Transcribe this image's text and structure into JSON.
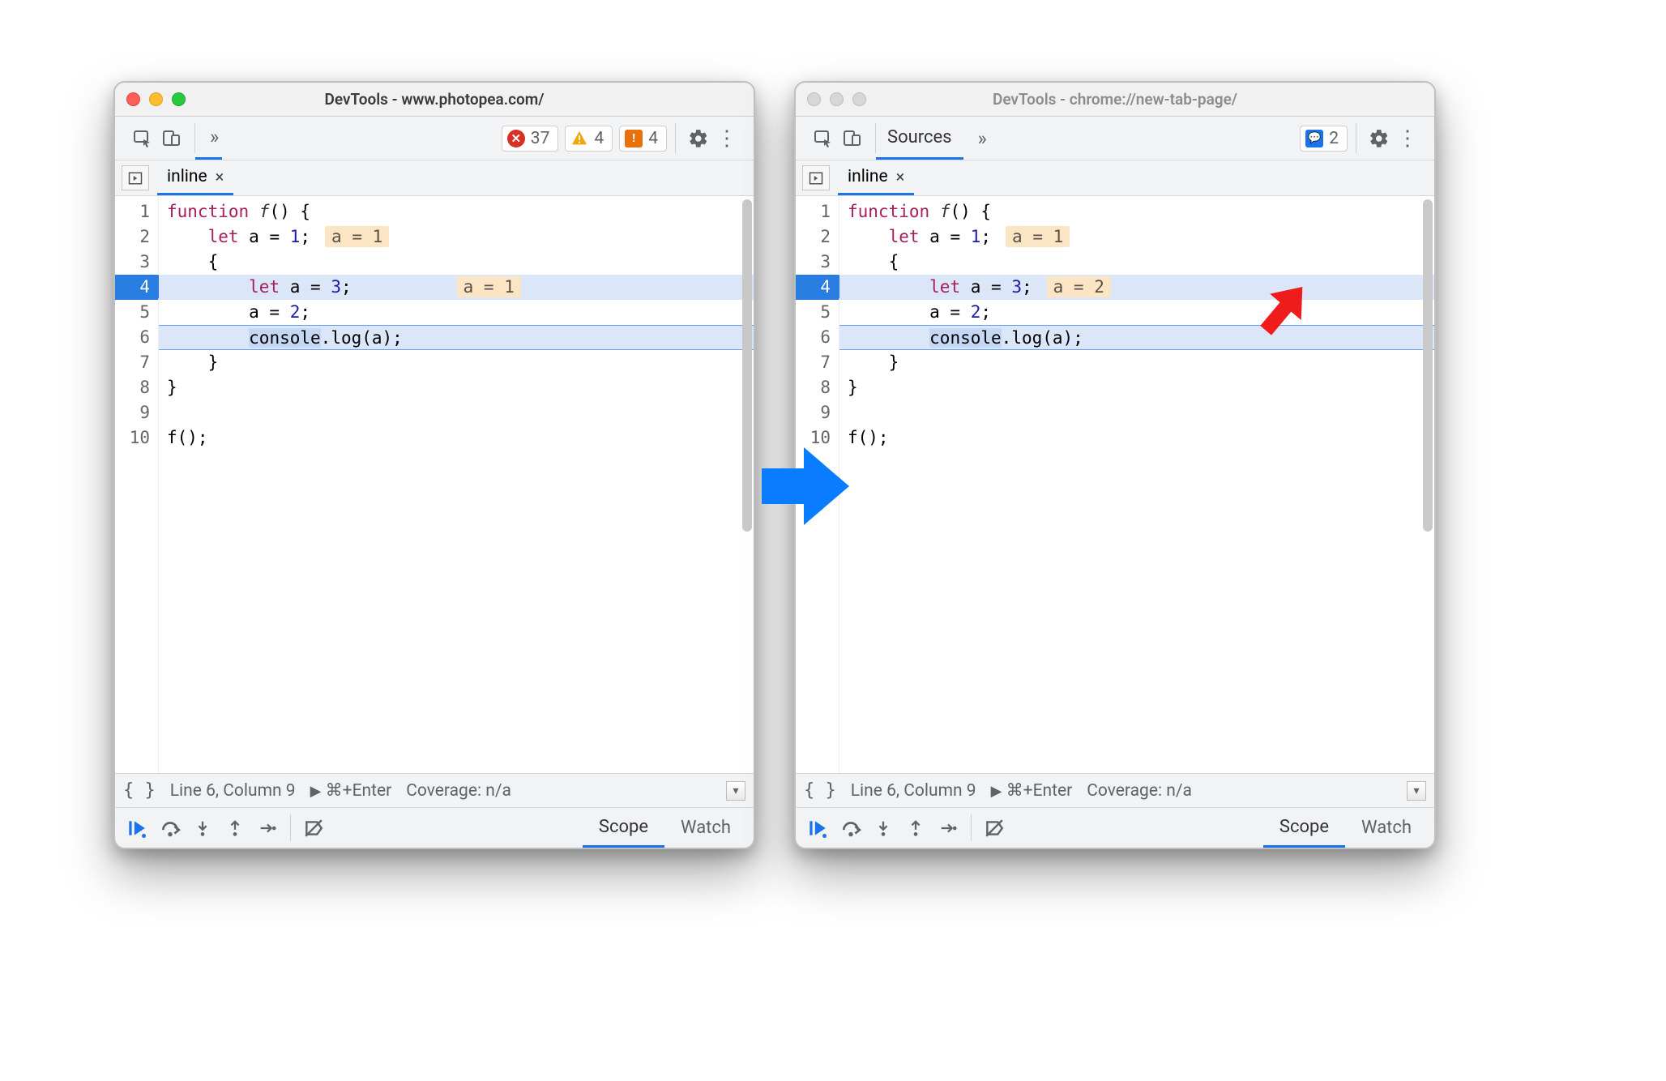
{
  "windows": {
    "left": {
      "active": true,
      "title": "DevTools - www.photopea.com/",
      "badges": {
        "errors": "37",
        "warnings_tri": "4",
        "warnings_sq": "4"
      }
    },
    "right": {
      "active": false,
      "title": "DevTools - chrome://new-tab-page/",
      "panel_label": "Sources",
      "badges": {
        "issues": "2"
      }
    }
  },
  "file_tab": {
    "name": "inline"
  },
  "code_lines": [
    "function f() {",
    "    let a = 1;",
    "    {",
    "        let a = 3;",
    "        a = 2;",
    "        console.log(a);",
    "    }",
    "}",
    "",
    "f();"
  ],
  "inline_values": {
    "left": {
      "line2": "a = 1",
      "line4": "a = 1"
    },
    "right": {
      "line2": "a = 1",
      "line4": "a = 2"
    }
  },
  "exec_line": 4,
  "active_line": 6,
  "status": {
    "cursor": "Line 6, Column 9",
    "shortcut": "⌘+Enter",
    "coverage": "Coverage: n/a"
  },
  "bottom_tabs": {
    "scope": "Scope",
    "watch": "Watch"
  },
  "raw": {
    "a_eq_3": "a = 3",
    "a_eq_2": "a = 2",
    "a_eq_1": "a = 1"
  }
}
